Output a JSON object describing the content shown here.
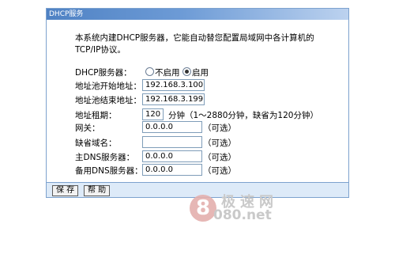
{
  "window": {
    "title": "DHCP服务"
  },
  "description": "本系统内建DHCP服务器，它能自动替您配置局域网中各计算机的TCP/IP协议。",
  "dhcp_server": {
    "label": "DHCP服务器：",
    "options": [
      "不启用",
      "启用"
    ],
    "selected": "启用"
  },
  "fields": {
    "pool_start": {
      "label": "地址池开始地址：",
      "value": "192.168.3.100"
    },
    "pool_end": {
      "label": "地址池结束地址：",
      "value": "192.168.3.199"
    },
    "lease": {
      "label": "地址租期：",
      "value": "120",
      "hint": "分钟（1～2880分钟，缺省为120分钟）"
    },
    "gateway": {
      "label": "网关：",
      "value": "0.0.0.0",
      "hint": "（可选）"
    },
    "domain": {
      "label": "缺省域名：",
      "value": "",
      "hint": "（可选）"
    },
    "primary_dns": {
      "label": "主DNS服务器：",
      "value": "0.0.0.0",
      "hint": "（可选）"
    },
    "secondary_dns": {
      "label": "备用DNS服务器：",
      "value": "0.0.0.0",
      "hint": "（可选）"
    }
  },
  "buttons": {
    "save": "保 存",
    "help": "帮 助"
  },
  "watermark": {
    "digit": "8",
    "text": "极速网",
    "url": "080.net"
  },
  "colors": {
    "title_bar": "#4f82c4",
    "bottom_bar": "#ddeaf8",
    "border": "#7da2ce"
  }
}
